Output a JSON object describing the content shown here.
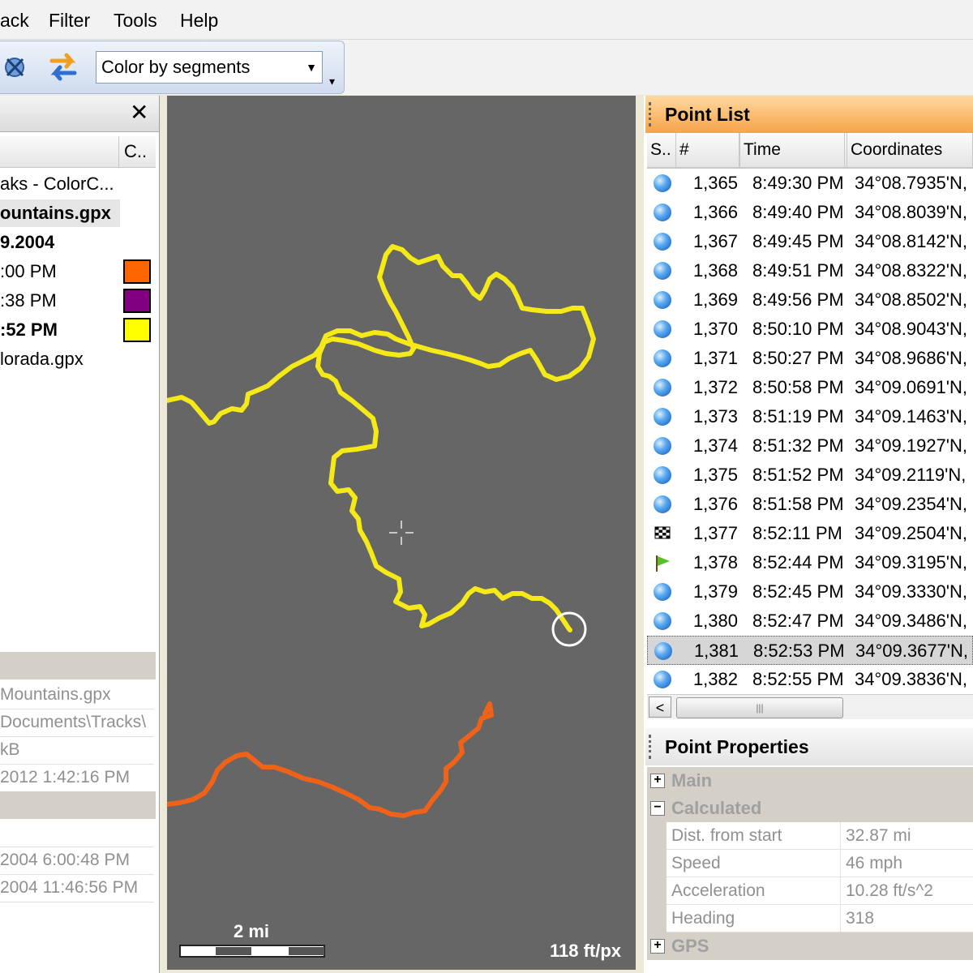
{
  "menu": {
    "items": [
      "ack",
      "Filter",
      "Tools",
      "Help"
    ]
  },
  "toolbar": {
    "color_mode": "Color by segments"
  },
  "left_panel": {
    "column_header": "C..",
    "tree": [
      {
        "label": "aks - ColorC...",
        "bold": false
      },
      {
        "label": "ountains.gpx",
        "bold": true
      },
      {
        "label": "9.2004",
        "bold": true
      },
      {
        "label": ":00 PM",
        "bold": false,
        "color": "#ff6600"
      },
      {
        "label": ":38 PM",
        "bold": false,
        "color": "#800080"
      },
      {
        "label": ":52 PM",
        "bold": true,
        "color": "#ffff00"
      },
      {
        "label": "lorada.gpx",
        "bold": false
      }
    ],
    "info": [
      "Mountains.gpx",
      "Documents\\Tracks\\",
      "kB",
      "2012 1:42:16 PM",
      "2004 6:00:48 PM",
      "2004 11:46:56 PM"
    ]
  },
  "map": {
    "scale_label": "2 mi",
    "resolution": "118 ft/px",
    "track_colors": {
      "yellow": "#f5ea18",
      "orange": "#f06218"
    }
  },
  "point_list": {
    "title": "Point List",
    "columns": [
      "S..",
      "#",
      "Time",
      "Coordinates"
    ],
    "rows": [
      {
        "icon": "ball",
        "num": "1,365",
        "time": "8:49:30 PM",
        "coord": "34°08.7935'N,"
      },
      {
        "icon": "ball",
        "num": "1,366",
        "time": "8:49:40 PM",
        "coord": "34°08.8039'N,"
      },
      {
        "icon": "ball",
        "num": "1,367",
        "time": "8:49:45 PM",
        "coord": "34°08.8142'N,"
      },
      {
        "icon": "ball",
        "num": "1,368",
        "time": "8:49:51 PM",
        "coord": "34°08.8322'N,"
      },
      {
        "icon": "ball",
        "num": "1,369",
        "time": "8:49:56 PM",
        "coord": "34°08.8502'N,"
      },
      {
        "icon": "ball",
        "num": "1,370",
        "time": "8:50:10 PM",
        "coord": "34°08.9043'N,"
      },
      {
        "icon": "ball",
        "num": "1,371",
        "time": "8:50:27 PM",
        "coord": "34°08.9686'N,"
      },
      {
        "icon": "ball",
        "num": "1,372",
        "time": "8:50:58 PM",
        "coord": "34°09.0691'N,"
      },
      {
        "icon": "ball",
        "num": "1,373",
        "time": "8:51:19 PM",
        "coord": "34°09.1463'N,"
      },
      {
        "icon": "ball",
        "num": "1,374",
        "time": "8:51:32 PM",
        "coord": "34°09.1927'N,"
      },
      {
        "icon": "ball",
        "num": "1,375",
        "time": "8:51:52 PM",
        "coord": "34°09.2119'N,"
      },
      {
        "icon": "ball",
        "num": "1,376",
        "time": "8:51:58 PM",
        "coord": "34°09.2354'N,"
      },
      {
        "icon": "checkered-flag",
        "num": "1,377",
        "time": "8:52:11 PM",
        "coord": "34°09.2504'N,"
      },
      {
        "icon": "green-flag",
        "num": "1,378",
        "time": "8:52:44 PM",
        "coord": "34°09.3195'N,"
      },
      {
        "icon": "ball",
        "num": "1,379",
        "time": "8:52:45 PM",
        "coord": "34°09.3330'N,"
      },
      {
        "icon": "ball",
        "num": "1,380",
        "time": "8:52:47 PM",
        "coord": "34°09.3486'N,"
      },
      {
        "icon": "ball",
        "num": "1,381",
        "time": "8:52:53 PM",
        "coord": "34°09.3677'N,",
        "selected": true
      },
      {
        "icon": "ball",
        "num": "1,382",
        "time": "8:52:55 PM",
        "coord": "34°09.3836'N,"
      }
    ]
  },
  "point_properties": {
    "title": "Point Properties",
    "categories": {
      "main": "Main",
      "calculated": "Calculated",
      "gps": "GPS"
    },
    "calculated_rows": [
      {
        "key": "Dist. from start",
        "value": "32.87 mi"
      },
      {
        "key": "Speed",
        "value": "46 mph"
      },
      {
        "key": "Acceleration",
        "value": "10.28 ft/s^2"
      },
      {
        "key": "Heading",
        "value": "318"
      }
    ]
  }
}
